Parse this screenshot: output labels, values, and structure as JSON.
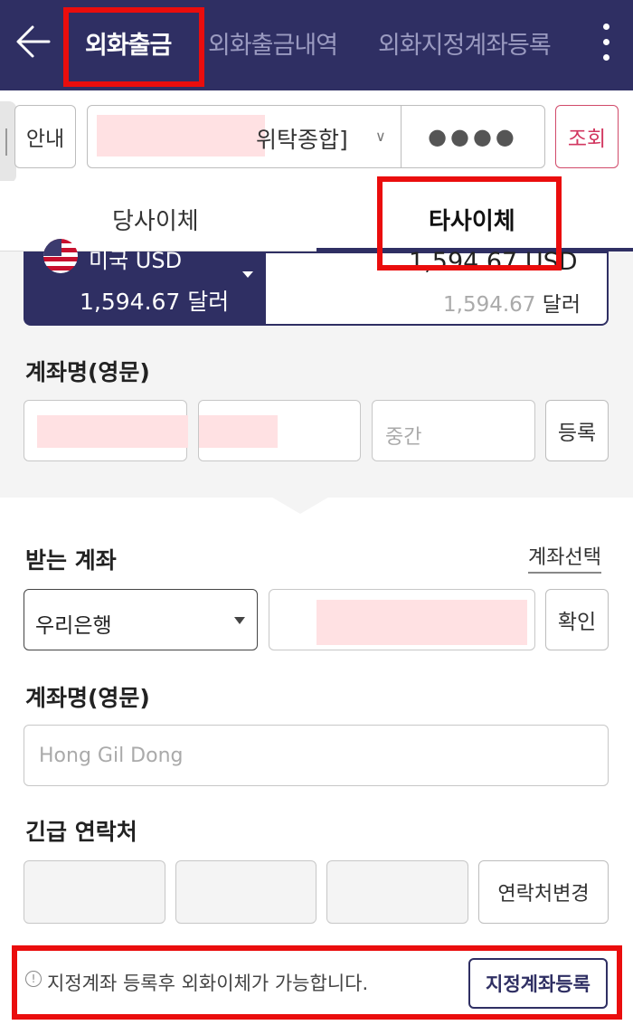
{
  "header": {
    "tabs": [
      {
        "label": "외화출금",
        "active": true
      },
      {
        "label": "외화출금내역",
        "active": false
      },
      {
        "label": "외화지정계좌등록",
        "active": false
      }
    ]
  },
  "account_bar": {
    "guide_label": "안내",
    "account_suffix": "위탁종합]",
    "password_mask": "●●●●",
    "lookup_label": "조회"
  },
  "transfer_tabs": [
    {
      "label": "당사이체",
      "active": false
    },
    {
      "label": "타사이체",
      "active": true
    }
  ],
  "currency": {
    "name": "미국 USD",
    "amount_left": "1,594.67 달러",
    "amount_big": "1,594.67 USD",
    "amount_small_value": "1,594.67",
    "amount_small_unit": "달러"
  },
  "sender": {
    "label": "계좌명(영문)",
    "middle_placeholder": "중간",
    "register_label": "등록"
  },
  "receiver": {
    "label": "받는 계좌",
    "select_account_link": "계좌선택",
    "bank": "우리은행",
    "confirm_label": "확인",
    "name_label": "계좌명(영문)",
    "name_placeholder": "Hong Gil Dong"
  },
  "emergency": {
    "label": "긴급 연락처",
    "change_label": "연락처변경"
  },
  "notice": {
    "icon": "!",
    "text": "지정계좌 등록후 외화이체가 가능합니다.",
    "button_label": "지정계좌등록"
  },
  "colors": {
    "primary": "#2f2f63",
    "highlight": "#ea0d0d",
    "accent": "#d23760"
  }
}
